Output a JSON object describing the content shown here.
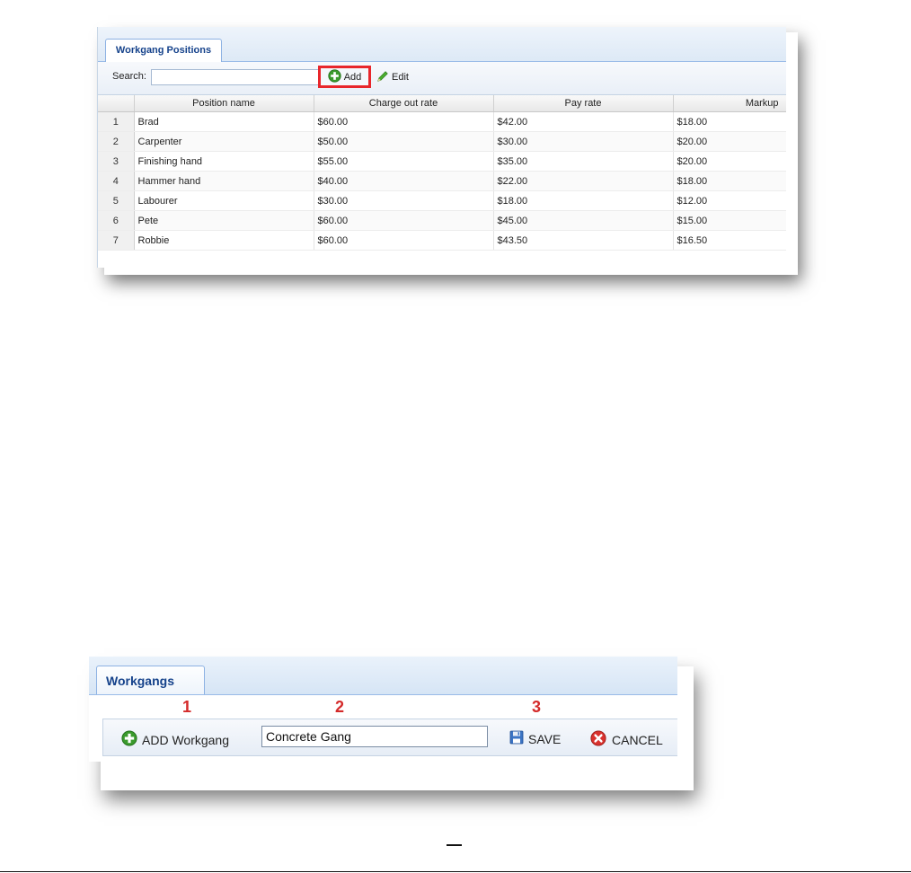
{
  "workgang_positions": {
    "tab_label": "Workgang Positions",
    "search": {
      "label": "Search:",
      "value": ""
    },
    "add_label": "Add",
    "edit_label": "Edit",
    "columns": [
      "Position name",
      "Charge out rate",
      "Pay rate",
      "Markup"
    ],
    "rows": [
      {
        "num": "1",
        "name": "Brad",
        "charge": "$60.00",
        "pay": "$42.00",
        "markup": "$18.00"
      },
      {
        "num": "2",
        "name": "Carpenter",
        "charge": "$50.00",
        "pay": "$30.00",
        "markup": "$20.00"
      },
      {
        "num": "3",
        "name": "Finishing hand",
        "charge": "$55.00",
        "pay": "$35.00",
        "markup": "$20.00"
      },
      {
        "num": "4",
        "name": "Hammer hand",
        "charge": "$40.00",
        "pay": "$22.00",
        "markup": "$18.00"
      },
      {
        "num": "5",
        "name": "Labourer",
        "charge": "$30.00",
        "pay": "$18.00",
        "markup": "$12.00"
      },
      {
        "num": "6",
        "name": "Pete",
        "charge": "$60.00",
        "pay": "$45.00",
        "markup": "$15.00"
      },
      {
        "num": "7",
        "name": "Robbie",
        "charge": "$60.00",
        "pay": "$43.50",
        "markup": "$16.50"
      }
    ],
    "highlight_color": "#e8262b"
  },
  "workgangs": {
    "tab_label": "Workgangs",
    "step_numbers": [
      "1",
      "2",
      "3"
    ],
    "add_label": "ADD Workgang",
    "name_value": "Concrete Gang",
    "save_label": "SAVE",
    "cancel_label": "CANCEL",
    "step_number_color": "#d42a2a"
  },
  "icons": {
    "add": "plus-circle-green",
    "edit": "pencil-green",
    "save": "floppy-disk-blue",
    "cancel": "x-circle-red"
  }
}
